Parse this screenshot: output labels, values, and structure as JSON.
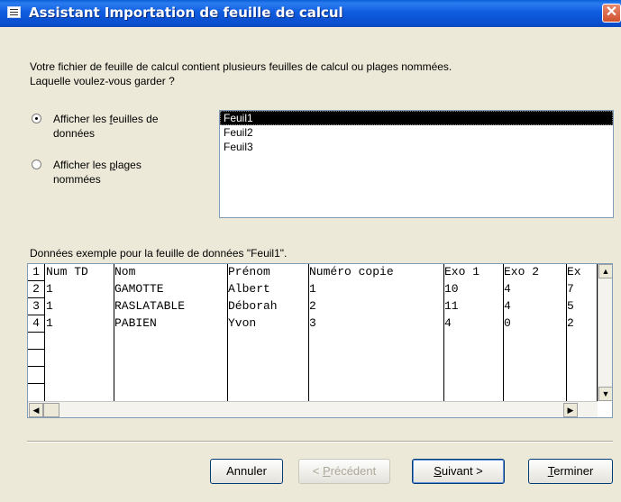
{
  "window": {
    "title": "Assistant Importation de feuille de calcul",
    "close_symbol": "✕",
    "icon": "datasheet-icon"
  },
  "intro_line1": "Votre fichier de feuille de calcul contient plusieurs feuilles de calcul ou plages nommées.",
  "intro_line2": "Laquelle voulez-vous garder ?",
  "options": {
    "sheets": {
      "pre": "Afficher les ",
      "key": "f",
      "post": "euilles de",
      "line2": "données",
      "selected": true
    },
    "ranges": {
      "pre": "Afficher les ",
      "key": "p",
      "post": "lages",
      "line2": "nommées",
      "selected": false
    }
  },
  "sheet_list": [
    "Feuil1",
    "Feuil2",
    "Feuil3"
  ],
  "sample_label": "Données exemple pour la feuille de données \"Feuil1\".",
  "grid": {
    "row_numbers": [
      "1",
      "2",
      "3",
      "4"
    ],
    "rows": [
      [
        "Num TD",
        "Nom",
        "Prénom",
        "Numéro copie",
        "Exo 1",
        "Exo 2",
        "Ex"
      ],
      [
        "1",
        "GAMOTTE",
        "Albert",
        "1",
        "10",
        "4",
        "7"
      ],
      [
        "1",
        "RASLATABLE",
        "Déborah",
        "2",
        "11",
        "4",
        "5"
      ],
      [
        "1",
        "PABIEN",
        "Yvon",
        "3",
        "4",
        "0",
        "2"
      ]
    ]
  },
  "scroll_glyphs": {
    "up": "▲",
    "down": "▼",
    "left": "◀",
    "right": "▶"
  },
  "buttons": {
    "cancel": "Annuler",
    "previous": {
      "pre": "< ",
      "key": "P",
      "post": "récédent"
    },
    "next": {
      "pre": "",
      "key": "S",
      "post": "uivant >"
    },
    "finish": {
      "pre": "",
      "key": "T",
      "post": "erminer"
    }
  }
}
